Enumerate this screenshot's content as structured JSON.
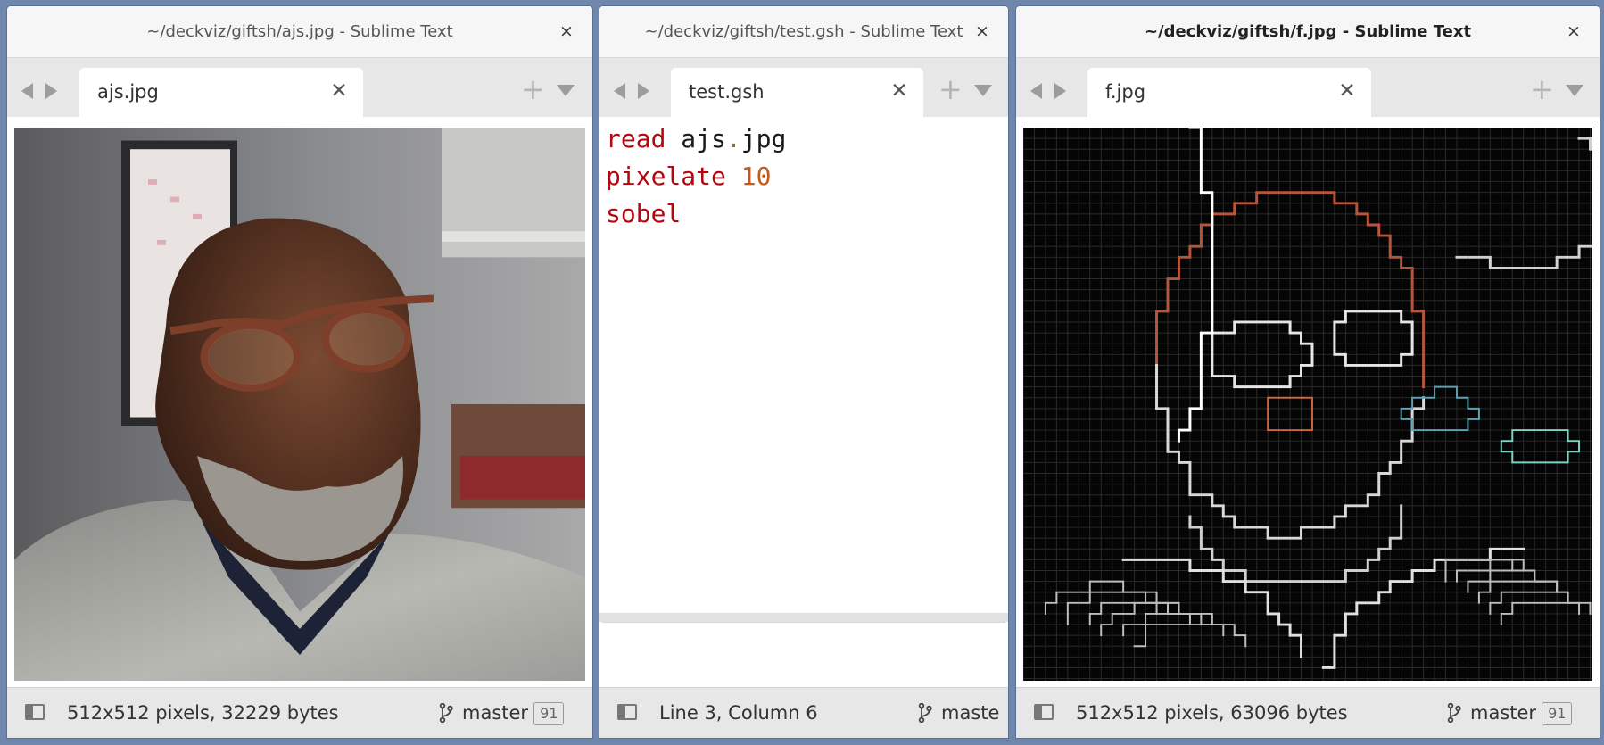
{
  "windows": [
    {
      "title": "~/deckviz/giftsh/ajs.jpg - Sublime Text",
      "tab": "ajs.jpg",
      "status_text": "512x512 pixels, 32229 bytes",
      "branch": "master",
      "badge": "91"
    },
    {
      "title": "~/deckviz/giftsh/test.gsh - Sublime Text",
      "tab": "test.gsh",
      "status_text": "Line 3, Column 6",
      "branch": "maste",
      "code": [
        {
          "kw": "read",
          "arg": "ajs",
          "dot": ".",
          "ext": "jpg"
        },
        {
          "kw": "pixelate",
          "num": "10"
        },
        {
          "kw": "sobel"
        }
      ]
    },
    {
      "title": "~/deckviz/giftsh/f.jpg - Sublime Text",
      "tab": "f.jpg",
      "status_text": "512x512 pixels, 63096 bytes",
      "branch": "master",
      "badge": "91"
    }
  ],
  "icons": {
    "window_close": "×",
    "tab_close": "✕",
    "new_tab": "+",
    "nav": [
      "back-arrow-icon",
      "forward-arrow-icon"
    ],
    "sidebar_toggle": "sidebar-toggle-icon",
    "branch": "git-branch-icon"
  },
  "colors": {
    "desktop": "#6f87ad",
    "keyword": "#b5050f",
    "number": "#c25a1a"
  }
}
